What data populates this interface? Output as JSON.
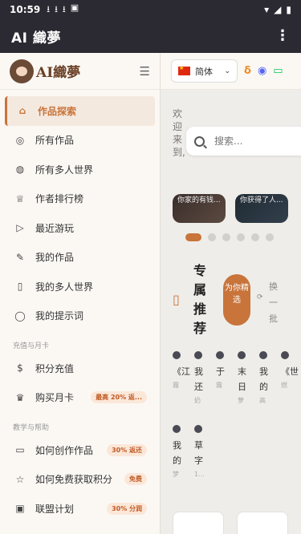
{
  "status": {
    "time": "10:59",
    "notifs": [
      "⭳",
      "⭳",
      "⭳",
      "▣"
    ],
    "right": [
      "▾",
      "◢",
      "▮"
    ]
  },
  "appbar": {
    "title": "AI 織夢",
    "menu": "⋮"
  },
  "sidebar": {
    "logo": "AI織夢",
    "toggle": "☰",
    "items": [
      {
        "label": "作品探索",
        "icon": "home-icon",
        "glyph": "⌂",
        "active": true
      },
      {
        "label": "所有作品",
        "icon": "compass-icon",
        "glyph": "◎"
      },
      {
        "label": "所有多人世界",
        "icon": "globe-icon",
        "glyph": "◍"
      },
      {
        "label": "作者排行榜",
        "icon": "trophy-icon",
        "glyph": "♕"
      },
      {
        "label": "最近游玩",
        "icon": "play-icon",
        "glyph": "▷"
      },
      {
        "label": "我的作品",
        "icon": "pencil-icon",
        "glyph": "✎"
      },
      {
        "label": "我的多人世界",
        "icon": "book-icon",
        "glyph": "▯"
      },
      {
        "label": "我的提示词",
        "icon": "chat-icon",
        "glyph": "◯"
      }
    ],
    "section1": "充值与月卡",
    "items2": [
      {
        "label": "积分充值",
        "icon": "coin-icon",
        "glyph": "$"
      },
      {
        "label": "购买月卡",
        "icon": "crown-icon",
        "glyph": "♛",
        "badge": "最高 20% 返..."
      }
    ],
    "section2": "教学与帮助",
    "items3": [
      {
        "label": "如何创作作品",
        "icon": "book-open-icon",
        "glyph": "▭",
        "badge": "30% 返还"
      },
      {
        "label": "如何免费获取积分",
        "icon": "star-icon",
        "glyph": "☆",
        "badge": "免费"
      },
      {
        "label": "联盟计划",
        "icon": "gift-icon",
        "glyph": "▣",
        "badge": "30% 分润"
      }
    ]
  },
  "main": {
    "lang": "简体",
    "welcome": "欢迎来到,",
    "search_placeholder": "搜索...",
    "cards": [
      "你家的有钱...",
      "你获得了人..."
    ],
    "exclusive_title": "专属推荐",
    "for_you": "为你精选",
    "change": "换一批",
    "works": [
      {
        "title": "《江",
        "sub": "霧"
      },
      {
        "title": "我还",
        "sub": "奶"
      },
      {
        "title": "于",
        "sub": "霧"
      },
      {
        "title": "末日",
        "sub": "萝"
      },
      {
        "title": "我的",
        "sub": "高"
      },
      {
        "title": "《世",
        "sub": "燃"
      },
      {
        "title": "我的",
        "sub": "梦"
      },
      {
        "title": "草字",
        "sub": "1..."
      }
    ]
  },
  "colors": {
    "accent": "#c8743a",
    "bar": "#2b2a33"
  }
}
